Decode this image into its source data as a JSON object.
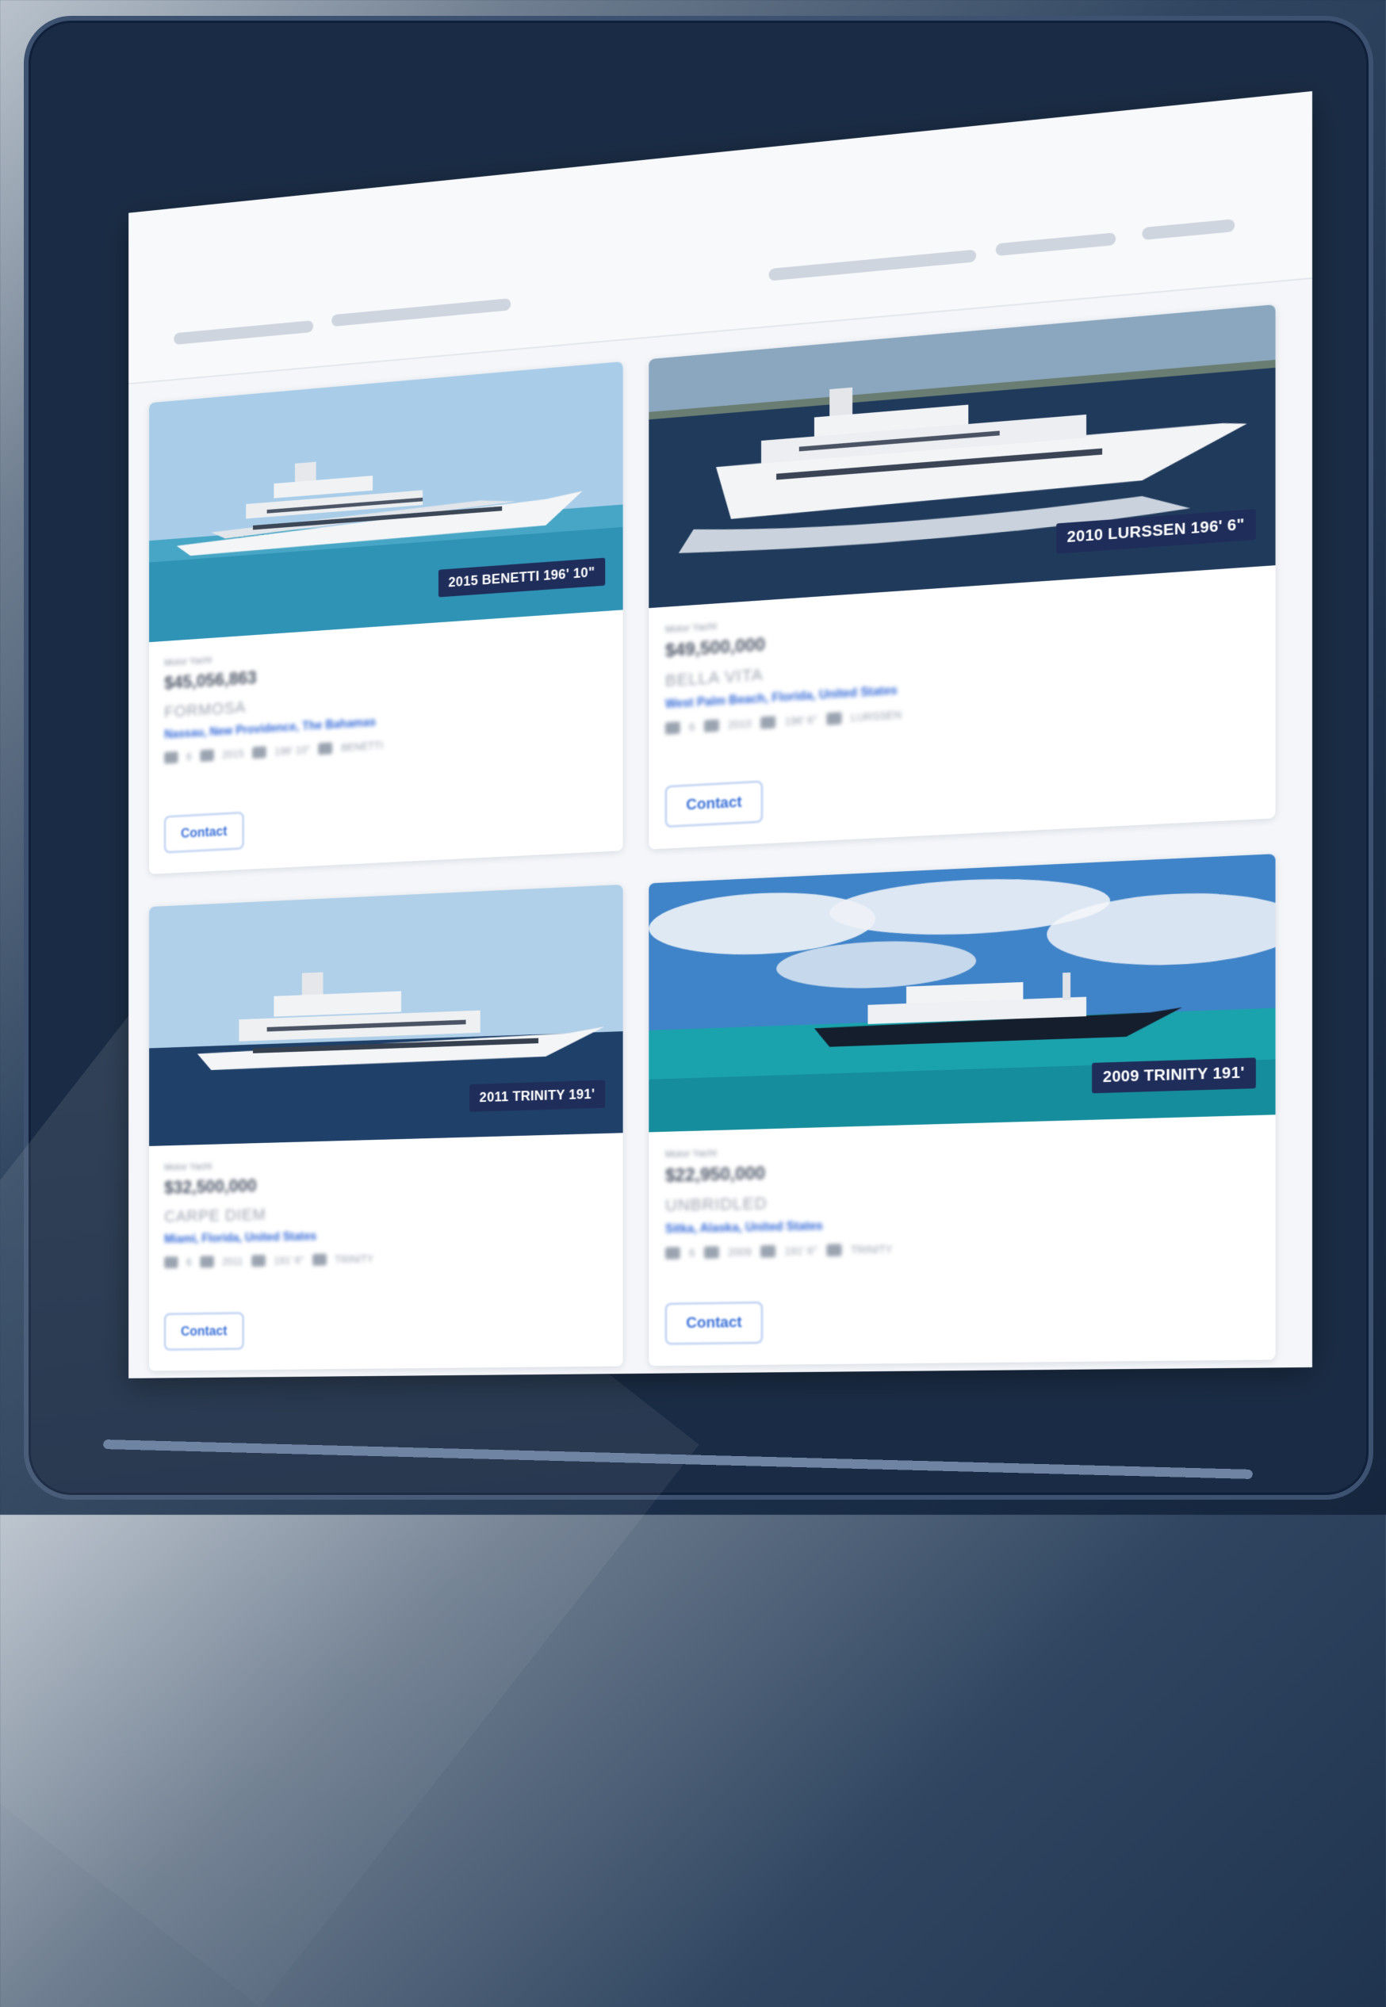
{
  "listings": [
    {
      "tag": "2015 BENETTI 196' 10\"",
      "type": "Motor Yacht",
      "price": "$45,056,863",
      "name": "FORMOSA",
      "location": "Nassau, New Providence, The Bahamas",
      "specs": {
        "guests": "6",
        "year": "2015",
        "length": "196' 10\"",
        "builder": "BENETTI"
      },
      "contact_label": "Contact",
      "colors": {
        "sky": "#9fc6e8",
        "sea": "#2e8fb3"
      }
    },
    {
      "tag": "2010 LURSSEN 196' 6\"",
      "type": "Motor Yacht",
      "price": "$49,500,000",
      "name": "BELLA VITA",
      "location": "West Palm Beach, Florida, United States",
      "specs": {
        "guests": "6",
        "year": "2010",
        "length": "196' 6\"",
        "builder": "LURSSEN"
      },
      "contact_label": "Contact",
      "colors": {
        "sky": "#7e9bb4",
        "sea": "#213a5a"
      }
    },
    {
      "tag": "2011 TRINITY 191'",
      "type": "Motor Yacht",
      "price": "$32,500,000",
      "name": "CARPE DIEM",
      "location": "Miami, Florida, United States",
      "specs": {
        "guests": "6",
        "year": "2011",
        "length": "191' 6\"",
        "builder": "TRINITY"
      },
      "contact_label": "Contact",
      "colors": {
        "sky": "#a8c9e6",
        "sea": "#1d3e67"
      }
    },
    {
      "tag": "2009 TRINITY 191'",
      "type": "Motor Yacht",
      "price": "$22,950,000",
      "name": "UNBRIDLED",
      "location": "Sitka, Alaska, United States",
      "specs": {
        "guests": "6",
        "year": "2009",
        "length": "191' 6\"",
        "builder": "TRINITY"
      },
      "contact_label": "Contact",
      "colors": {
        "sky": "#3f83c9",
        "sea": "#1fa5b0"
      }
    }
  ]
}
